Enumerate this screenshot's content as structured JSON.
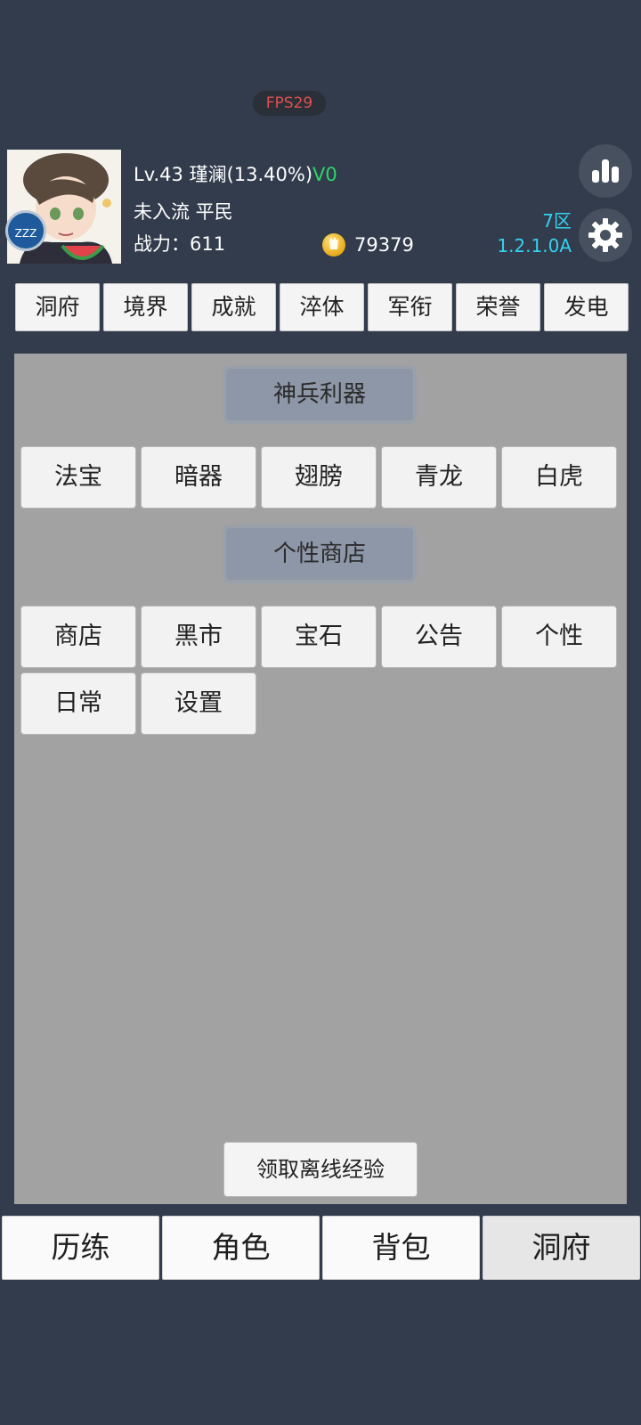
{
  "fps": "FPS29",
  "player": {
    "level_line": "Lv.43 瑾澜(13.40%)",
    "vip": "V0",
    "rank": "未入流 平民",
    "power": "战力：611",
    "gold": "79379",
    "sleep_badge": "ZZZ"
  },
  "server": {
    "zone": "7区",
    "version": "1.2.1.0A"
  },
  "icons": {
    "stats": "bar-chart-icon",
    "settings": "gear-icon",
    "coin": "coin-icon"
  },
  "tabs": [
    "洞府",
    "境界",
    "成就",
    "淬体",
    "军衔",
    "荣誉",
    "发电"
  ],
  "sections": {
    "weapons": {
      "title": "神兵利器",
      "items": [
        "法宝",
        "暗器",
        "翅膀",
        "青龙",
        "白虎"
      ]
    },
    "shop": {
      "title": "个性商店",
      "items": [
        "商店",
        "黑市",
        "宝石",
        "公告",
        "个性",
        "日常",
        "设置"
      ]
    }
  },
  "offline_button": "领取离线经验",
  "bottom_nav": [
    "历练",
    "角色",
    "背包",
    "洞府"
  ],
  "colors": {
    "accent_cyan": "#33d2f0",
    "vip_green": "#2fd36a",
    "fps_red": "#e05050"
  }
}
